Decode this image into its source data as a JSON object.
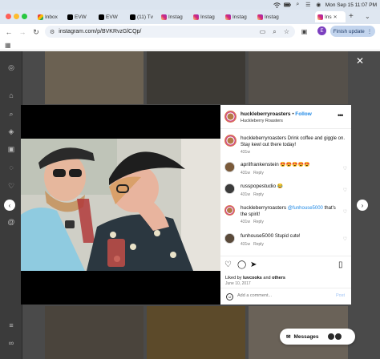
{
  "os": {
    "menubar": {
      "datetime": "Mon Sep 15  11:07 PM",
      "icons": [
        "wifi-icon",
        "battery-icon",
        "search-icon",
        "control-center-icon",
        "siri-icon"
      ]
    }
  },
  "browser": {
    "tabs": [
      {
        "label": "Inbox",
        "icon": "gmail-icon",
        "active": false
      },
      {
        "label": "EVW",
        "icon": "x-icon",
        "active": false
      },
      {
        "label": "EVW",
        "icon": "x-icon",
        "active": false
      },
      {
        "label": "(11) Tv",
        "icon": "x-icon",
        "active": false
      },
      {
        "label": "Instag",
        "icon": "instagram-icon",
        "active": false
      },
      {
        "label": "Instag",
        "icon": "instagram-icon",
        "active": false
      },
      {
        "label": "Instag",
        "icon": "instagram-icon",
        "active": false
      },
      {
        "label": "Instag",
        "icon": "instagram-icon",
        "active": false
      },
      {
        "label": "Ins",
        "icon": "instagram-icon",
        "active": true
      }
    ],
    "url": "instagram.com/p/BVKRvzGlCQp/",
    "profile_initial": "E",
    "update_label": "Finish update"
  },
  "post": {
    "username": "huckleberryroasters",
    "follow_label": "Follow",
    "subtitle": "Huckleberry Roasters",
    "caption_user": "huckleberryroasters",
    "caption_text": "Drink coffee and giggle on. Stay kewl out there today!",
    "caption_time": "431w",
    "comments": [
      {
        "user": "aprilfrankenstein",
        "text": "😍😍😍😍😍",
        "time": "431w",
        "reply": "Reply"
      },
      {
        "user": "russpopestudio",
        "text": "😂",
        "time": "431w",
        "reply": "Reply"
      },
      {
        "user": "huckleberryroasters",
        "mention": "@funhouse5000",
        "text": "that's the spirit!",
        "time": "431w",
        "reply": "Reply"
      },
      {
        "user": "funhouse5000",
        "text": "Stupid cute!",
        "time": "431w",
        "reply": "Reply"
      }
    ],
    "liked_prefix": "Liked by ",
    "liked_user": "luvcooks",
    "liked_mid": " and ",
    "liked_suffix": "others",
    "date": "June 10, 2017",
    "add_comment_placeholder": "Add a comment...",
    "post_label": "Post"
  },
  "messages_label": "Messages",
  "colors": {
    "instagram_blue": "#1e88e5",
    "update_button_bg": "#c3d5ee",
    "overlay_bg": "#4a4a4a"
  }
}
